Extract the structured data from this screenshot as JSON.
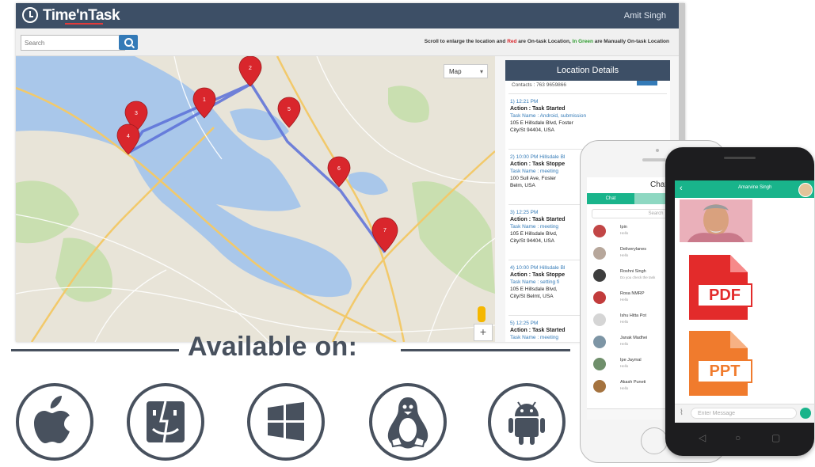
{
  "app": {
    "logo_text": "Time'nTask",
    "user_name": "Amit Singh",
    "search_placeholder": "Search",
    "legend_prefix": "Scroll to enlarge the location and ",
    "legend_red": "Red",
    "legend_mid": " are On-task Location, ",
    "legend_green": "In Green",
    "legend_suffix": " are Manually On-task Location",
    "map_type": "Map",
    "zoom_plus": "+"
  },
  "map": {
    "pin_labels": [
      "1",
      "2",
      "3",
      "4",
      "5",
      "6",
      "7"
    ],
    "pin_color": "#d9262c",
    "route_color": "#5b6fd9"
  },
  "details": {
    "title": "Location Details",
    "cut_line": "Contacts : 763 9659866",
    "entries": [
      {
        "time": "1) 12:21 PM",
        "action": "Action : Task Started",
        "task": "Task Name : Android, submission",
        "address": "105 E Hillsdale Blvd, Foster",
        "city": "City/St 94404, USA"
      },
      {
        "time": "2) 10:00 PM Hillsdale Bl",
        "action": "Action : Task Stoppe",
        "task": "Task Name : meeting",
        "address": "100 Sull Ave, Foster",
        "city": "Belm, USA"
      },
      {
        "time": "3) 12:25 PM",
        "action": "Action : Task Started",
        "task": "Task Name : meeting",
        "address": "105 E Hillsdale Blvd,",
        "city": "City/St 94404, USA"
      },
      {
        "time": "4) 10:00 PM Hillsdale Bl",
        "action": "Action : Task Stoppe",
        "task": "Task Name : setting fi",
        "address": "105 E Hillsdale Blvd,",
        "city": "City/St Belmt, USA"
      },
      {
        "time": "5) 12:25 PM",
        "action": "Action : Task Started",
        "task": "Task Name : meeting",
        "address": "",
        "city": ""
      }
    ]
  },
  "available": {
    "title": "Available on:",
    "platforms": [
      "apple-icon",
      "finder-icon",
      "windows-icon",
      "linux-icon",
      "android-icon"
    ],
    "color": "#48515e"
  },
  "iphone": {
    "title": "Chat",
    "tabs": [
      "Chat",
      "Contacts"
    ],
    "search": "Search",
    "contacts": [
      {
        "name": "Ipin",
        "sub": "Hello"
      },
      {
        "name": "Deliverylanes",
        "sub": "Hello"
      },
      {
        "name": "Roshni Singh",
        "sub": "Do you check the task"
      },
      {
        "name": "Rosa NMRP",
        "sub": "Hello"
      },
      {
        "name": "Ishu Hitta Pot",
        "sub": "Hello"
      },
      {
        "name": "Janak Madhei",
        "sub": "Hello"
      },
      {
        "name": "Ipe Jaymal",
        "sub": "Hello"
      },
      {
        "name": "Akash Puneti",
        "sub": "Hello"
      }
    ]
  },
  "android": {
    "contact_name": "Amarvine Singh",
    "pdf_label": "PDF",
    "ppt_label": "PPT",
    "pdf_color": "#e32b2b",
    "ppt_color": "#f07b2d",
    "input_placeholder": "Enter Message",
    "accent": "#19b48b"
  }
}
